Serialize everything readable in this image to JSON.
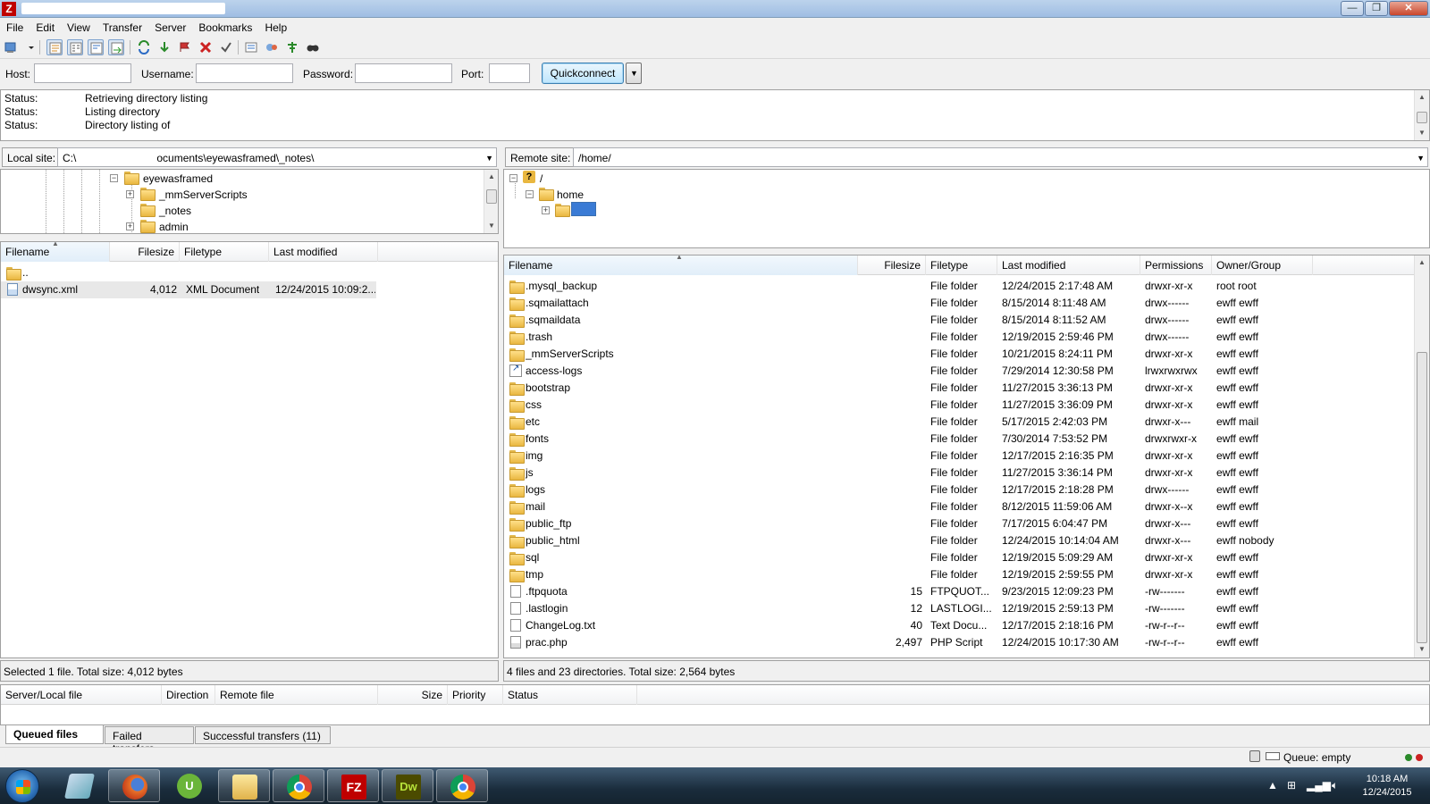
{
  "app": {
    "logo_text": "Z"
  },
  "menu": [
    "File",
    "Edit",
    "View",
    "Transfer",
    "Server",
    "Bookmarks",
    "Help"
  ],
  "quickconnect": {
    "host_label": "Host:",
    "host_value": "",
    "username_label": "Username:",
    "username_value": "",
    "password_label": "Password:",
    "password_value": "",
    "port_label": "Port:",
    "port_value": "",
    "button_label": "Quickconnect"
  },
  "log": [
    {
      "label": "Status:",
      "message": "Retrieving directory listing"
    },
    {
      "label": "Status:",
      "message": "Listing directory"
    },
    {
      "label": "Status:",
      "message": "Directory listing of"
    }
  ],
  "local": {
    "site_label": "Local site:",
    "site_path_start": "C:\\",
    "site_path_end": "ocuments\\eyewasframed\\_notes\\",
    "tree": [
      {
        "label": "eyewasframed",
        "expander": "−"
      },
      {
        "label": "_mmServerScripts",
        "expander": "+"
      },
      {
        "label": "_notes",
        "expander": ""
      },
      {
        "label": "admin",
        "expander": "+"
      }
    ],
    "columns": [
      "Filename",
      "Filesize",
      "Filetype",
      "Last modified"
    ],
    "files": [
      {
        "name": "..",
        "icon": "folder-icon",
        "size": "",
        "type": "",
        "modified": ""
      },
      {
        "name": "dwsync.xml",
        "icon": "xml-file-icon",
        "size": "4,012",
        "type": "XML Document",
        "modified": "12/24/2015 10:09:2..."
      }
    ],
    "status": "Selected 1 file. Total size: 4,012 bytes"
  },
  "remote": {
    "site_label": "Remote site:",
    "site_path": "/home/",
    "tree": [
      {
        "label": "/",
        "expander": "−"
      },
      {
        "label": "home",
        "expander": "−"
      },
      {
        "label": "",
        "expander": "+"
      }
    ],
    "columns": [
      "Filename",
      "Filesize",
      "Filetype",
      "Last modified",
      "Permissions",
      "Owner/Group"
    ],
    "files": [
      {
        "name": ".mysql_backup",
        "icon": "folder-icon",
        "size": "",
        "type": "File folder",
        "modified": "12/24/2015 2:17:48 AM",
        "perms": "drwxr-xr-x",
        "owner": "root root"
      },
      {
        "name": ".sqmailattach",
        "icon": "folder-icon",
        "size": "",
        "type": "File folder",
        "modified": "8/15/2014 8:11:48 AM",
        "perms": "drwx------",
        "owner": "ewff ewff"
      },
      {
        "name": ".sqmaildata",
        "icon": "folder-icon",
        "size": "",
        "type": "File folder",
        "modified": "8/15/2014 8:11:52 AM",
        "perms": "drwx------",
        "owner": "ewff ewff"
      },
      {
        "name": ".trash",
        "icon": "folder-icon",
        "size": "",
        "type": "File folder",
        "modified": "12/19/2015 2:59:46 PM",
        "perms": "drwx------",
        "owner": "ewff ewff"
      },
      {
        "name": "_mmServerScripts",
        "icon": "folder-icon",
        "size": "",
        "type": "File folder",
        "modified": "10/21/2015 8:24:11 PM",
        "perms": "drwxr-xr-x",
        "owner": "ewff ewff"
      },
      {
        "name": "access-logs",
        "icon": "symlink-icon",
        "size": "",
        "type": "File folder",
        "modified": "7/29/2014 12:30:58 PM",
        "perms": "lrwxrwxrwx",
        "owner": "ewff ewff"
      },
      {
        "name": "bootstrap",
        "icon": "folder-icon",
        "size": "",
        "type": "File folder",
        "modified": "11/27/2015 3:36:13 PM",
        "perms": "drwxr-xr-x",
        "owner": "ewff ewff"
      },
      {
        "name": "css",
        "icon": "folder-icon",
        "size": "",
        "type": "File folder",
        "modified": "11/27/2015 3:36:09 PM",
        "perms": "drwxr-xr-x",
        "owner": "ewff ewff"
      },
      {
        "name": "etc",
        "icon": "folder-icon",
        "size": "",
        "type": "File folder",
        "modified": "5/17/2015 2:42:03 PM",
        "perms": "drwxr-x---",
        "owner": "ewff mail"
      },
      {
        "name": "fonts",
        "icon": "folder-icon",
        "size": "",
        "type": "File folder",
        "modified": "7/30/2014 7:53:52 PM",
        "perms": "drwxrwxr-x",
        "owner": "ewff ewff"
      },
      {
        "name": "img",
        "icon": "folder-icon",
        "size": "",
        "type": "File folder",
        "modified": "12/17/2015 2:16:35 PM",
        "perms": "drwxr-xr-x",
        "owner": "ewff ewff"
      },
      {
        "name": "js",
        "icon": "folder-icon",
        "size": "",
        "type": "File folder",
        "modified": "11/27/2015 3:36:14 PM",
        "perms": "drwxr-xr-x",
        "owner": "ewff ewff"
      },
      {
        "name": "logs",
        "icon": "folder-icon",
        "size": "",
        "type": "File folder",
        "modified": "12/17/2015 2:18:28 PM",
        "perms": "drwx------",
        "owner": "ewff ewff"
      },
      {
        "name": "mail",
        "icon": "folder-icon",
        "size": "",
        "type": "File folder",
        "modified": "8/12/2015 11:59:06 AM",
        "perms": "drwxr-x--x",
        "owner": "ewff ewff"
      },
      {
        "name": "public_ftp",
        "icon": "folder-icon",
        "size": "",
        "type": "File folder",
        "modified": "7/17/2015 6:04:47 PM",
        "perms": "drwxr-x---",
        "owner": "ewff ewff"
      },
      {
        "name": "public_html",
        "icon": "folder-icon",
        "size": "",
        "type": "File folder",
        "modified": "12/24/2015 10:14:04 AM",
        "perms": "drwxr-x---",
        "owner": "ewff nobody"
      },
      {
        "name": "sql",
        "icon": "folder-icon",
        "size": "",
        "type": "File folder",
        "modified": "12/19/2015 5:09:29 AM",
        "perms": "drwxr-xr-x",
        "owner": "ewff ewff"
      },
      {
        "name": "tmp",
        "icon": "folder-icon",
        "size": "",
        "type": "File folder",
        "modified": "12/19/2015 2:59:55 PM",
        "perms": "drwxr-xr-x",
        "owner": "ewff ewff"
      },
      {
        "name": ".ftpquota",
        "icon": "file-icon",
        "size": "15",
        "type": "FTPQUOT...",
        "modified": "9/23/2015 12:09:23 PM",
        "perms": "-rw-------",
        "owner": "ewff ewff"
      },
      {
        "name": ".lastlogin",
        "icon": "file-icon",
        "size": "12",
        "type": "LASTLOGI...",
        "modified": "12/19/2015 2:59:13 PM",
        "perms": "-rw-------",
        "owner": "ewff ewff"
      },
      {
        "name": "ChangeLog.txt",
        "icon": "text-file-icon",
        "size": "40",
        "type": "Text Docu...",
        "modified": "12/17/2015 2:18:16 PM",
        "perms": "-rw-r--r--",
        "owner": "ewff ewff"
      },
      {
        "name": "prac.php",
        "icon": "php-file-icon",
        "size": "2,497",
        "type": "PHP Script",
        "modified": "12/24/2015 10:17:30 AM",
        "perms": "-rw-r--r--",
        "owner": "ewff ewff"
      }
    ],
    "status": "4 files and 23 directories. Total size: 2,564 bytes"
  },
  "queue": {
    "columns": [
      "Server/Local file",
      "Direction",
      "Remote file",
      "Size",
      "Priority",
      "Status"
    ],
    "tabs": [
      "Queued files",
      "Failed transfers",
      "Successful transfers (11)"
    ],
    "status": "Queue: empty"
  },
  "taskbar": {
    "apps": [
      "windows-explorer-icon",
      "firefox-icon",
      "utorrent-icon",
      "file-explorer-icon",
      "chrome-icon",
      "filezilla-icon",
      "dreamweaver-icon",
      "chrome-icon"
    ],
    "utorrent_glyph": "U",
    "filezilla_glyph": "FZ",
    "dreamweaver_glyph": "Dw",
    "time": "10:18 AM",
    "date": "12/24/2015"
  },
  "colors": {
    "accent": "#3c7fb1",
    "filezilla_red": "#bf0000",
    "dreamweaver": "#4b4b00"
  }
}
